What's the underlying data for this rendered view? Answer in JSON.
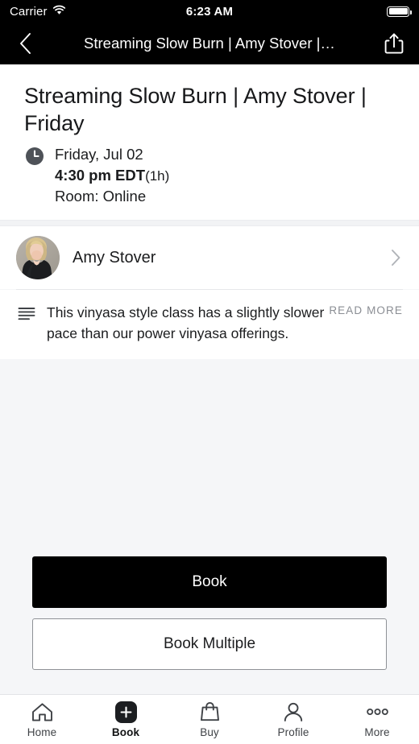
{
  "statusbar": {
    "carrier": "Carrier",
    "time": "6:23 AM",
    "wifi_icon": "wifi-icon",
    "battery_icon": "battery-full-icon"
  },
  "navbar": {
    "back_icon": "chevron-left-icon",
    "title": "Streaming Slow Burn | Amy Stover |…",
    "share_icon": "share-icon"
  },
  "class_detail": {
    "title": "Streaming Slow Burn | Amy Stover | Friday",
    "clock_icon": "clock-icon",
    "date": "Friday, Jul 02",
    "time": "4:30 pm EDT",
    "duration": "(1h)",
    "room": "Room: Online"
  },
  "instructor": {
    "avatar_icon": "instructor-avatar",
    "name": "Amy Stover",
    "chevron_icon": "chevron-right-icon"
  },
  "description": {
    "icon": "description-lines-icon",
    "text": "This vinyasa style class has a slightly slower pace than our power vinyasa offerings.",
    "read_more_label": "READ MORE"
  },
  "actions": {
    "book_label": "Book",
    "book_multiple_label": "Book Multiple"
  },
  "tabbar": {
    "items": [
      {
        "label": "Home",
        "icon": "home-icon",
        "active": false
      },
      {
        "label": "Book",
        "icon": "plus-square-icon",
        "active": true
      },
      {
        "label": "Buy",
        "icon": "shopping-bag-icon",
        "active": false
      },
      {
        "label": "Profile",
        "icon": "person-icon",
        "active": false
      },
      {
        "label": "More",
        "icon": "ellipsis-icon",
        "active": false
      }
    ]
  },
  "colors": {
    "nav_background": "#000000",
    "page_background": "#f5f6f8",
    "card_background": "#ffffff",
    "primary_button": "#000000",
    "muted_text": "#8a8d93"
  }
}
